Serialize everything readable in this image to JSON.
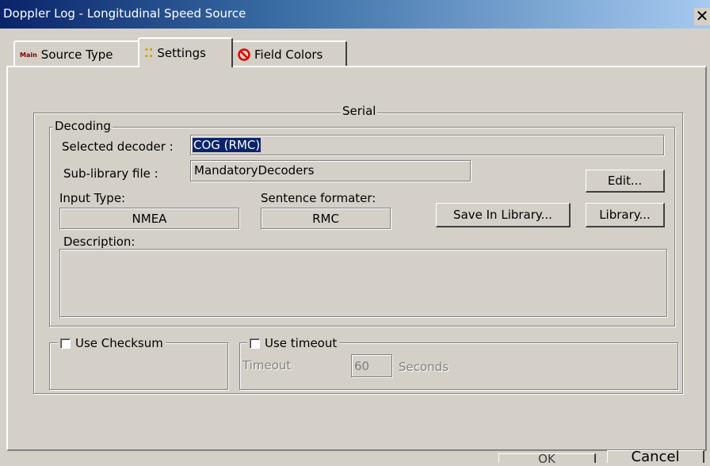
{
  "window": {
    "title": "Doppler Log - Longitudinal Speed Source",
    "close_glyph": "✕"
  },
  "tabs": [
    {
      "icon_text": "Main",
      "label": "Source Type"
    },
    {
      "icon_text": "⁚⁚",
      "label": "Settings"
    },
    {
      "icon_text": "⦸",
      "label": "Field Colors"
    }
  ],
  "serial": {
    "label": "Serial",
    "decoding": {
      "label": "Decoding",
      "selected_decoder_label": "Selected decoder :",
      "selected_decoder_value": "COG (RMC)",
      "sublibrary_label": "Sub-library file :",
      "sublibrary_value": "MandatoryDecoders",
      "input_type_label": "Input Type:",
      "input_type_value": "NMEA",
      "sentence_formatter_label": "Sentence formater:",
      "sentence_formatter_value": "RMC",
      "description_label": "Description:",
      "description_value": "",
      "edit_button": "Edit...",
      "save_library_button": "Save In Library...",
      "library_button": "Library..."
    },
    "checksum": {
      "label": "Use Checksum",
      "checked": false
    },
    "timeout": {
      "label": "Use timeout",
      "checked": false,
      "timeout_label": "Timeout",
      "timeout_value": "60",
      "unit": "Seconds"
    }
  },
  "footer": {
    "ok": "OK",
    "cancel": "Cancel"
  }
}
